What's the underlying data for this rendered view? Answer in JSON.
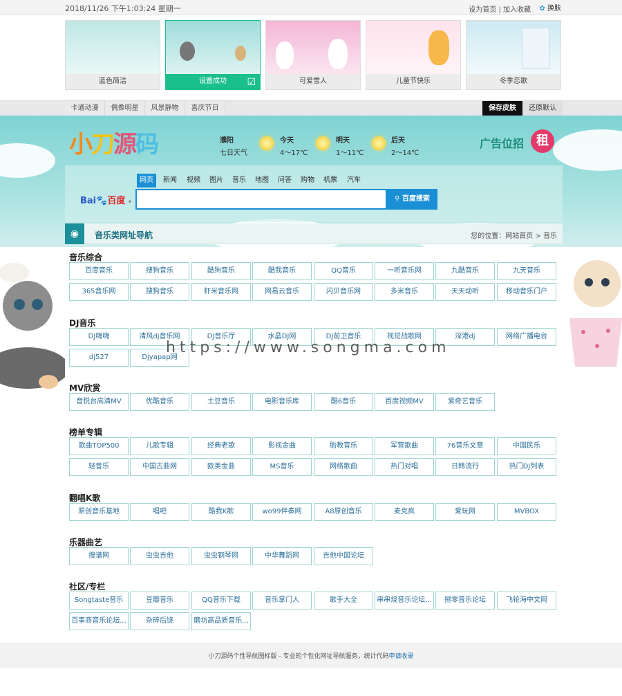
{
  "topbar": {
    "datetime": "2018/11/26 下午1:03:24 星期一",
    "set_home": "设为首页",
    "sep": " | ",
    "add_fav": "加入收藏",
    "change_skin": "换肤"
  },
  "skins": [
    {
      "name": "蓝色简洁"
    },
    {
      "name": "设置成功"
    },
    {
      "name": "可爱雪人"
    },
    {
      "name": "儿童节快乐"
    },
    {
      "name": "冬季恋歌"
    }
  ],
  "skin_tabs": [
    "卡通动漫",
    "偶像明星",
    "风景静物",
    "喜庆节日"
  ],
  "skin_actions": {
    "save": "保存皮肤",
    "reset": "还原默认"
  },
  "logo": [
    "小",
    "刀",
    "源",
    "码"
  ],
  "weather": {
    "city": "濮阳",
    "seven": "七日天气",
    "days": [
      {
        "label": "今天",
        "temp": "4～17℃"
      },
      {
        "label": "明天",
        "temp": "1～11℃"
      },
      {
        "label": "后天",
        "temp": "2～14℃"
      }
    ]
  },
  "ad": {
    "text": "广告位招",
    "badge": "租"
  },
  "search": {
    "tabs": [
      "网页",
      "新闻",
      "视频",
      "图片",
      "音乐",
      "地图",
      "问答",
      "购物",
      "机票",
      "汽车"
    ],
    "engine_a": "Bai",
    "engine_b": "百度",
    "button": "百度搜索"
  },
  "page": {
    "icon": "◉",
    "title": "音乐类网址导航",
    "crumb": "您的位置：网站首页 > 音乐"
  },
  "sections": [
    {
      "title": "音乐综合",
      "links": [
        "百度音乐",
        "搜狗音乐",
        "酷狗音乐",
        "酷我音乐",
        "QQ音乐",
        "一听音乐网",
        "九酷音乐",
        "九天音乐",
        "365音乐网",
        "搜狗音乐",
        "虾米音乐网",
        "网易云音乐",
        "闪贝音乐网",
        "多米音乐",
        "天天动听",
        "移动音乐门户"
      ]
    },
    {
      "title": "DJ音乐",
      "links": [
        "DJ嗨嗨",
        "清风dj音乐网",
        "DJ音乐厅",
        "水晶DJ网",
        "DJ前卫音乐",
        "视觉战歌网",
        "深港dj",
        "网络广播电台",
        "dj527",
        "Djyapap网"
      ]
    },
    {
      "title": "MV欣赏",
      "links": [
        "音悦台高清MV",
        "优酷音乐",
        "土豆音乐",
        "电影音乐库",
        "酷6音乐",
        "百度视频MV",
        "爱奇艺音乐"
      ]
    },
    {
      "title": "榜单专辑",
      "links": [
        "歌曲TOP500",
        "儿歌专辑",
        "经典老歌",
        "影视金曲",
        "胎教音乐",
        "军营歌曲",
        "76音乐文章",
        "中国民乐",
        "轻音乐",
        "中国古曲网",
        "欧美金曲",
        "MS音乐",
        "网络歌曲",
        "热门对唱",
        "日韩流行",
        "热门DJ列表"
      ]
    },
    {
      "title": "翻唱K歌",
      "links": [
        "原创音乐基地",
        "唱吧",
        "酷我K歌",
        "wo99伴奏网",
        "A8原创音乐",
        "麦克疯",
        "爱玩网",
        "MVBOX"
      ]
    },
    {
      "title": "乐器曲艺",
      "links": [
        "搜谱网",
        "虫虫吉他",
        "虫虫钢琴网",
        "中华舞蹈网",
        "吉他中国论坛"
      ]
    },
    {
      "title": "社区/专栏",
      "links": [
        "Songtaste音乐",
        "豆瓣音乐",
        "QQ音乐下载",
        "音乐掌门人",
        "歌手大全",
        "串串烧音乐论坛...",
        "捌零音乐论坛",
        "飞轮海中文网",
        "百事商音乐论坛...",
        "杂碎后饶",
        "磨坊高品质音乐..."
      ]
    }
  ],
  "watermark": "https://www.songma.com",
  "footer": {
    "text": "小刀源码个性导航图标版 - 专业的个性化网址导航服务，统计代码",
    "link": "申请收录"
  },
  "colors": {
    "accent": "#1b8fd6",
    "teal": "#1b8f9a",
    "active_skin": "#1bbf8a",
    "link_border": "#9fd4d0"
  }
}
